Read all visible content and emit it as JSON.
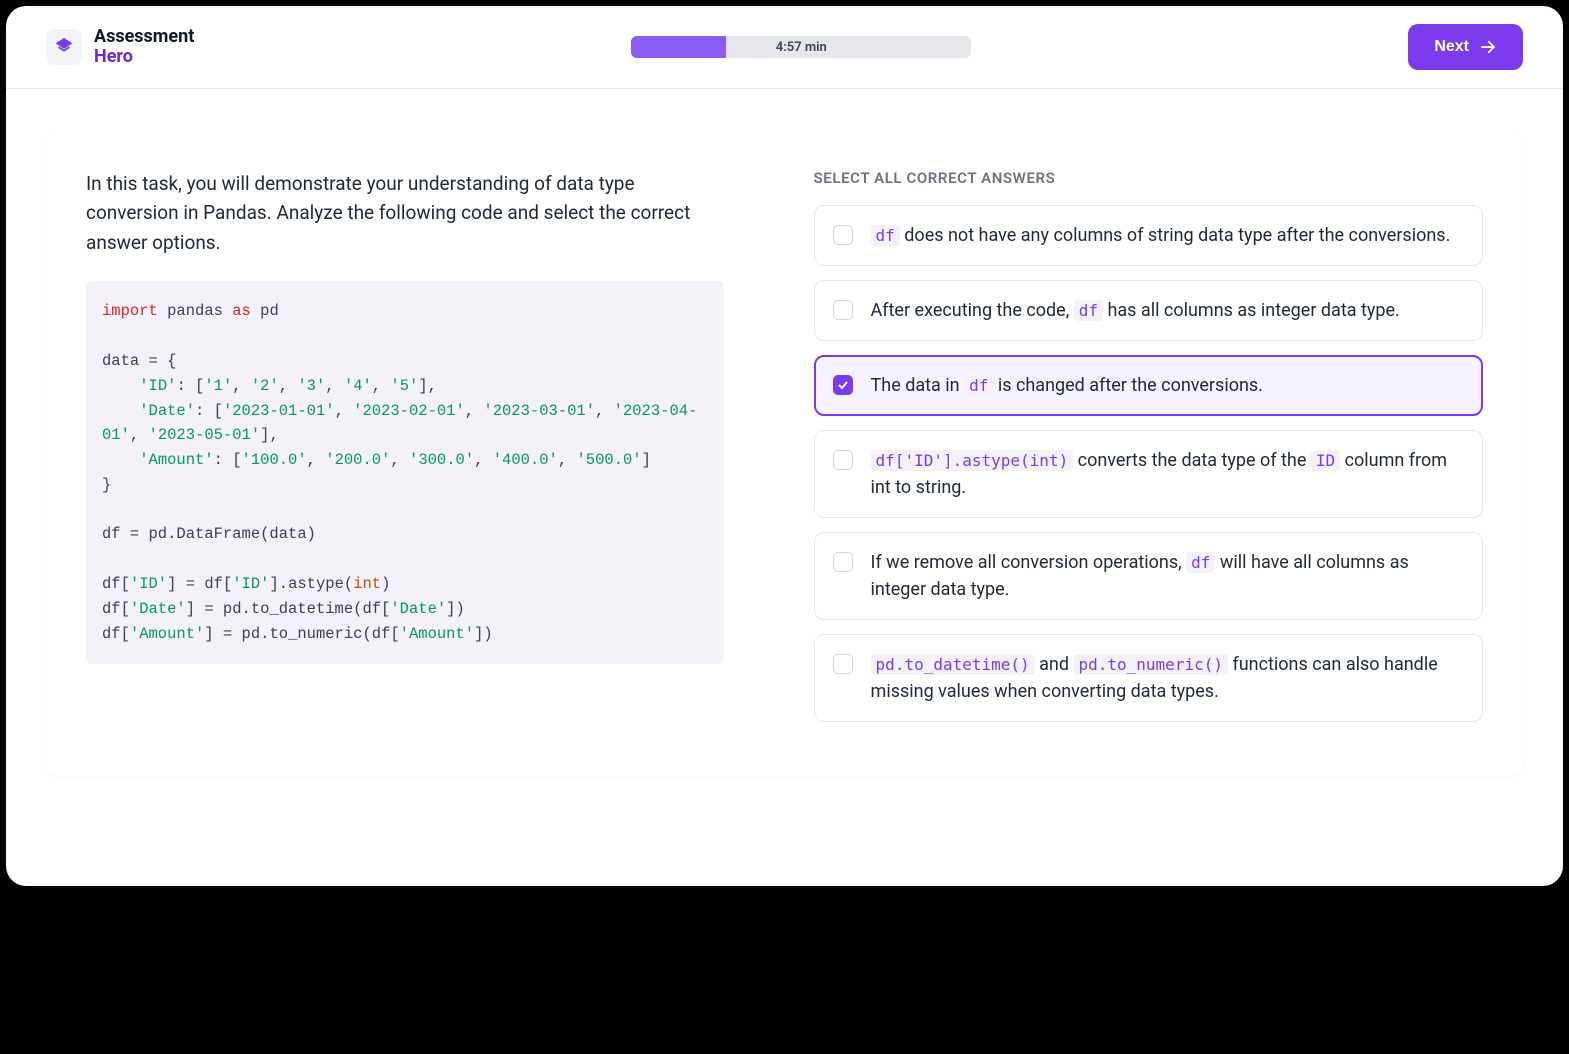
{
  "header": {
    "logo_top": "Assessment",
    "logo_bottom": "Hero",
    "timer": "4:57 min",
    "next_label": "Next"
  },
  "task": {
    "description": "In this task, you will demonstrate your understanding of data type conversion in Pandas. Analyze the following code and select the correct answer options."
  },
  "answers_label": "SELECT ALL CORRECT ANSWERS",
  "options": {
    "o1_pre": "df",
    "o1_post": " does not have any columns of string data type after the conversions.",
    "o2_pre": "After executing the code, ",
    "o2_code": "df",
    "o2_post": " has all columns as integer data type.",
    "o3_pre": "The data in ",
    "o3_code": "df",
    "o3_post": " is changed after the conversions.",
    "o4_code1": "df['ID'].astype(int)",
    "o4_mid": " converts the data type of the ",
    "o4_code2": "ID",
    "o4_post": " column from int to string.",
    "o5_pre": "If we remove all conversion operations, ",
    "o5_code": "df",
    "o5_post": " will have all columns as integer data type.",
    "o6_code1": "pd.to_datetime()",
    "o6_mid": " and ",
    "o6_code2": "pd.to_numeric()",
    "o6_post": " functions can also handle missing values when converting data types."
  },
  "code": {
    "kw_import": "import",
    "pandas": " pandas ",
    "kw_as": "as",
    "pd": " pd",
    "l2": "data = {",
    "l3a": "    ",
    "l3s1": "'ID'",
    "l3b": ": [",
    "l3s2": "'1'",
    "sep": ", ",
    "l3s3": "'2'",
    "l3s4": "'3'",
    "l3s5": "'4'",
    "l3s6": "'5'",
    "l3c": "],",
    "l4s1": "'Date'",
    "l4s2": "'2023-01-01'",
    "l4s3": "'2023-02-01'",
    "l4s4": "'2023-03-01'",
    "l4s5": "'2023-04-01'",
    "l4s6": "'2023-05-01'",
    "l5s1": "'Amount'",
    "l5s2": "'100.0'",
    "l5s3": "'200.0'",
    "l5s4": "'300.0'",
    "l5s5": "'400.0'",
    "l5s6": "'500.0'",
    "l5c": "]",
    "l6": "}",
    "l7": "df = pd.DataFrame(data)",
    "l8a": "df[",
    "l8s": "'ID'",
    "l8b": "] = df[",
    "l8c": "].astype(",
    "l8int": "int",
    "l8d": ")",
    "l9s": "'Date'",
    "l9b": "] = pd.to_datetime(df[",
    "l9c": "])",
    "l10s": "'Amount'",
    "l10b": "] = pd.to_numeric(df["
  }
}
